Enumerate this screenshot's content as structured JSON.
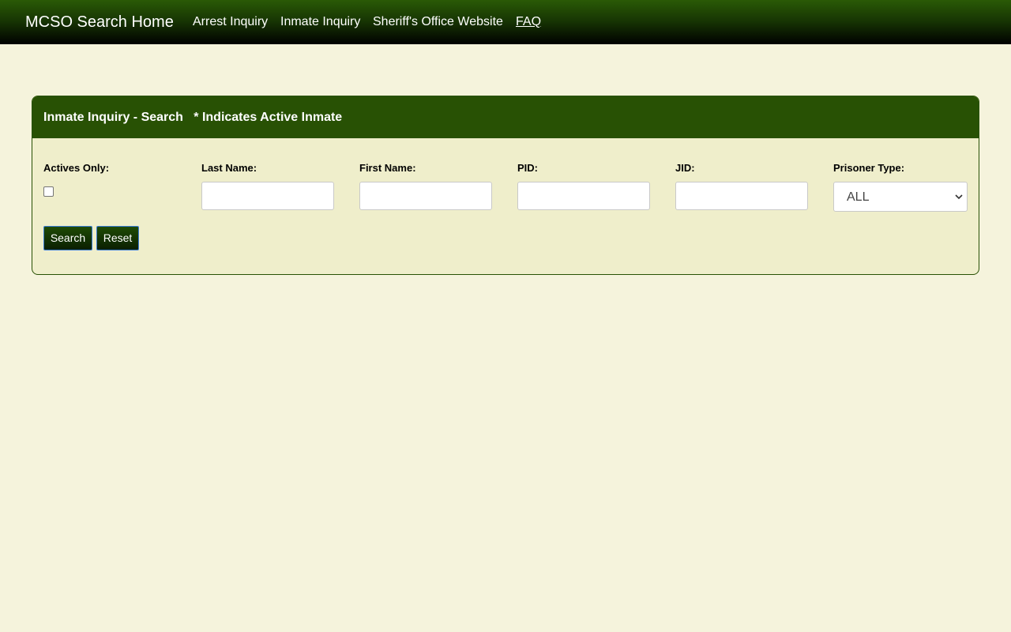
{
  "nav": {
    "brand": "MCSO Search Home",
    "links": [
      "Arrest Inquiry",
      "Inmate Inquiry",
      "Sheriff's Office Website",
      "FAQ"
    ]
  },
  "panel": {
    "title": "Inmate Inquiry - Search   * Indicates Active Inmate"
  },
  "form": {
    "actives_only_label": "Actives Only:",
    "actives_only_checked": false,
    "last_name_label": "Last Name:",
    "last_name_value": "",
    "first_name_label": "First Name:",
    "first_name_value": "",
    "pid_label": "PID:",
    "pid_value": "",
    "jid_label": "JID:",
    "jid_value": "",
    "prisoner_type_label": "Prisoner Type:",
    "prisoner_type_value": "ALL",
    "search_button": "Search",
    "reset_button": "Reset"
  },
  "colors": {
    "page_bg": "#f5f3dc",
    "panel_header": "#285104",
    "panel_body": "#efeecb"
  }
}
